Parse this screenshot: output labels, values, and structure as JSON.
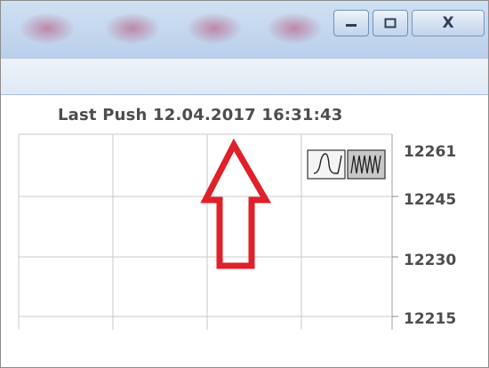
{
  "window": {
    "minimize_icon": "minimize-icon",
    "maximize_icon": "maximize-icon",
    "close_icon": "close-icon",
    "close_glyph": "X"
  },
  "chart_header": {
    "last_push_label": "Last Push 12.04.2017 16:31:43"
  },
  "chart_controls": {
    "icons": [
      "single-wave-icon",
      "multi-wave-icon"
    ]
  },
  "annotation": {
    "arrow_icon": "up-arrow-icon",
    "arrow_color": "#e0202a"
  },
  "chart_data": {
    "type": "line",
    "title": "",
    "xlabel": "",
    "ylabel": "",
    "y_ticks": [
      "12261",
      "12245",
      "12230",
      "12215"
    ],
    "ylim": [
      12207,
      12262
    ],
    "grid": true,
    "series": []
  },
  "colors": {
    "titlebar": "#c3d6ee",
    "grid": "#c8c8c8",
    "text": "#4d4d4d"
  }
}
